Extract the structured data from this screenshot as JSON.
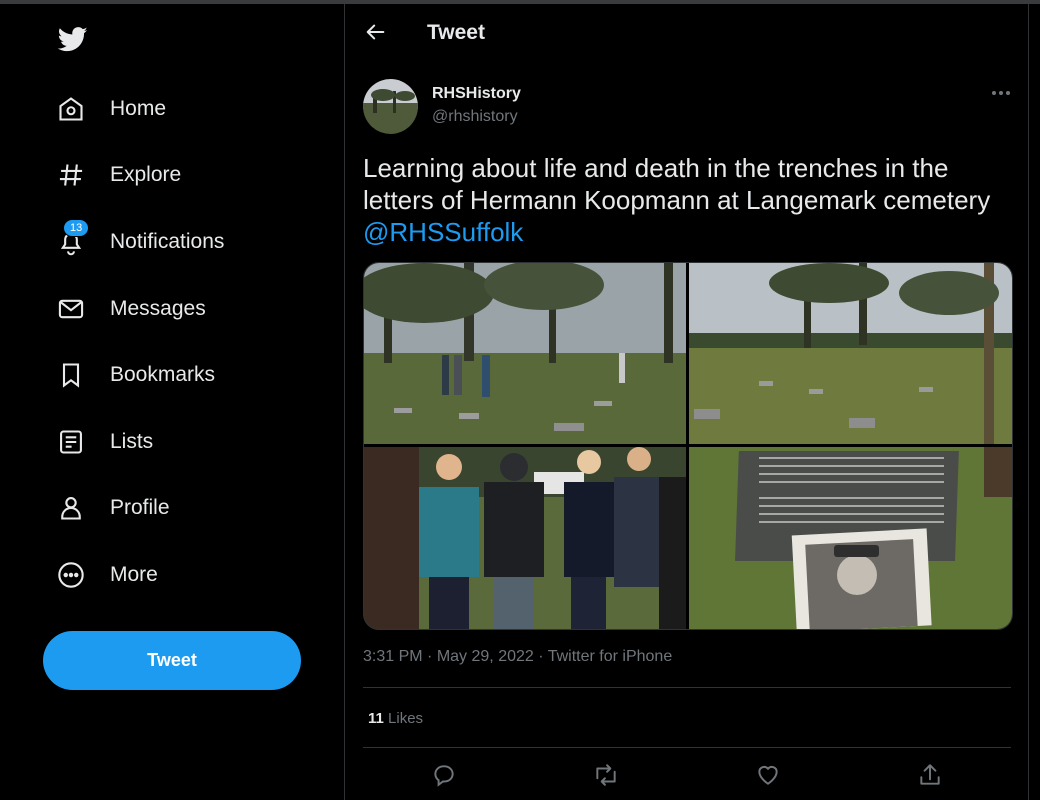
{
  "sidebar": {
    "items": [
      {
        "label": "Home",
        "icon": "home-icon"
      },
      {
        "label": "Explore",
        "icon": "hashtag-icon"
      },
      {
        "label": "Notifications",
        "icon": "bell-icon",
        "badge": "13"
      },
      {
        "label": "Messages",
        "icon": "envelope-icon"
      },
      {
        "label": "Bookmarks",
        "icon": "bookmark-icon"
      },
      {
        "label": "Lists",
        "icon": "list-icon"
      },
      {
        "label": "Profile",
        "icon": "person-icon"
      },
      {
        "label": "More",
        "icon": "more-circle-icon"
      }
    ],
    "tweet_button": "Tweet"
  },
  "header": {
    "title": "Tweet"
  },
  "tweet": {
    "author_name": "RHSHistory",
    "author_handle": "@rhshistory",
    "text": "Learning about life and death in the trenches in the letters of Hermann Koopmann at Langemark cemetery ",
    "mention": "@RHSSuffolk",
    "time": "3:31 PM",
    "date": "May 29, 2022",
    "source": "Twitter for iPhone",
    "likes_count": "11",
    "likes_label": "Likes",
    "photo_count": 4
  },
  "colors": {
    "accent": "#1d9bf0",
    "background": "#000000",
    "text": "#e7e9ea",
    "muted": "#71767b",
    "border": "#2f3336"
  }
}
